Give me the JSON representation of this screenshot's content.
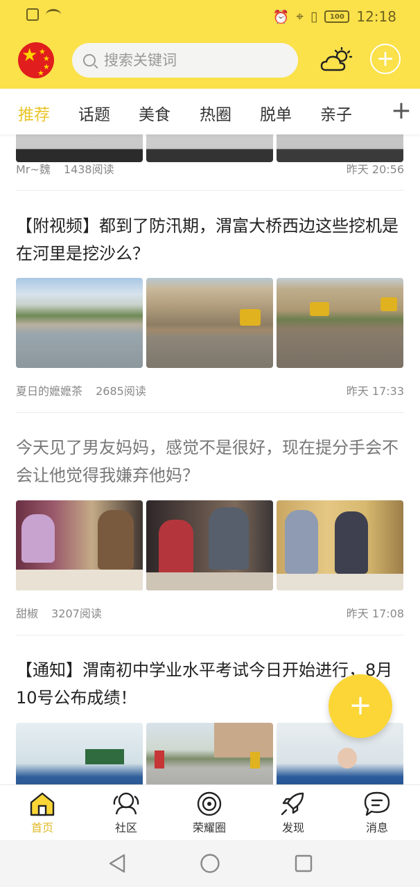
{
  "status_bar": {
    "time": "12:18",
    "battery": "100"
  },
  "header": {
    "search_placeholder": "搜索关键词"
  },
  "tabs": [
    {
      "label": "推荐",
      "active": true
    },
    {
      "label": "话题"
    },
    {
      "label": "美食"
    },
    {
      "label": "热圈"
    },
    {
      "label": "脱单"
    },
    {
      "label": "亲子"
    }
  ],
  "feed": {
    "items": [
      {
        "title": "",
        "author": "Mr~魏",
        "reads": "1438阅读",
        "time": "昨天 20:56"
      },
      {
        "title": "【附视频】都到了防汛期，渭富大桥西边这些挖机是在河里是挖沙么？",
        "author": "夏日的嬷嬷茶",
        "reads": "2685阅读",
        "time": "昨天 17:33"
      },
      {
        "title": "今天见了男友妈妈，感觉不是很好，现在提分手会不会让他觉得我嫌弃他妈？",
        "author": "甜椒",
        "reads": "3207阅读",
        "time": "昨天 17:08"
      },
      {
        "title": "【通知】渭南初中学业水平考试今日开始进行，8月10号公布成绩！",
        "author": "",
        "reads": "",
        "time": ""
      }
    ]
  },
  "fab": {
    "symbol": "+"
  },
  "bottom_nav": [
    {
      "label": "首页",
      "icon": "home-icon",
      "active": true
    },
    {
      "label": "社区",
      "icon": "community-icon"
    },
    {
      "label": "荣耀圈",
      "icon": "honor-circle-icon"
    },
    {
      "label": "发现",
      "icon": "rocket-icon"
    },
    {
      "label": "消息",
      "icon": "message-icon"
    }
  ],
  "colors": {
    "brand": "#fbe14a",
    "accent": "#e9c52a",
    "fab": "#fbd636"
  }
}
